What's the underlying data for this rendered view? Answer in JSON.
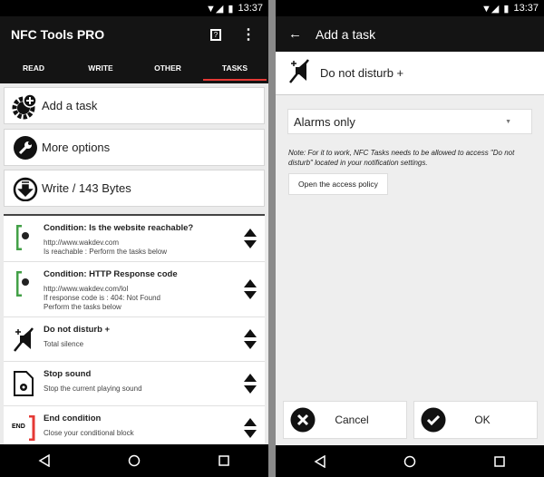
{
  "status": {
    "time": "13:37"
  },
  "left": {
    "title": "NFC Tools PRO",
    "tabs": [
      "READ",
      "WRITE",
      "OTHER",
      "TASKS"
    ],
    "active_tab": "TASKS",
    "buttons": {
      "add": "Add a task",
      "more": "More options",
      "write": "Write / 143 Bytes"
    },
    "tasks": [
      {
        "title": "Condition: Is the website reachable?",
        "lines": [
          "http://www.wakdev.com",
          "Is reachable : Perform the tasks below"
        ],
        "icon": "web-condition-icon"
      },
      {
        "title": "Condition: HTTP Response code",
        "lines": [
          "http://www.wakdev.com/lol",
          "If response code is : 404: Not Found",
          "Perform the tasks below"
        ],
        "icon": "web-condition-icon"
      },
      {
        "title": "Do not disturb +",
        "lines": [
          "Total silence"
        ],
        "icon": "do-not-disturb-icon"
      },
      {
        "title": "Stop sound",
        "lines": [
          "Stop the current playing sound"
        ],
        "icon": "stop-sound-icon"
      },
      {
        "title": "End condition",
        "lines": [
          "Close your conditional block"
        ],
        "icon": "end-condition-icon",
        "icon_text": "END"
      }
    ]
  },
  "right": {
    "title": "Add a task",
    "task_name": "Do not disturb +",
    "mode": "Alarms only",
    "note": "Note: For it to work, NFC Tasks needs to be allowed to access \"Do not disturb\" located in your notification settings.",
    "policy_button": "Open the access policy",
    "cancel": "Cancel",
    "ok": "OK"
  },
  "colors": {
    "condition": "#43a047",
    "end": "#e53935",
    "tab_indicator": "#e53935"
  }
}
